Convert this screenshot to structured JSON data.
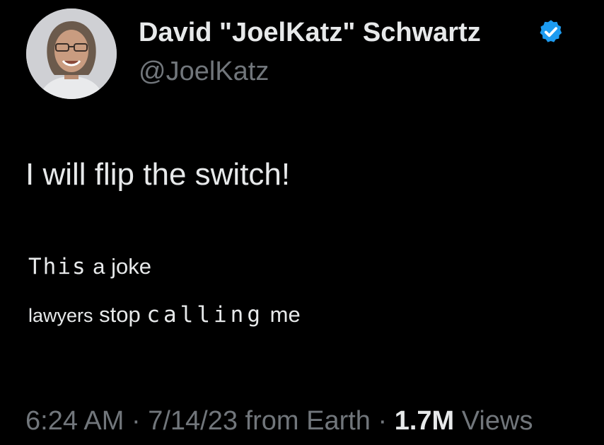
{
  "author": {
    "display_name": "David \"JoelKatz\" Schwartz",
    "handle": "@JoelKatz",
    "verified_icon": "verified-badge-icon",
    "verified_color": "#1d9bf0"
  },
  "tweet": {
    "line1": "I will flip the switch!",
    "line2": {
      "part1": "This",
      "part2": " a ",
      "part3": "joke"
    },
    "line3": {
      "part1": "lawyers",
      "part2": " stop ",
      "part3": "calling",
      "part4": " me"
    }
  },
  "meta": {
    "time": "6:24 AM",
    "sep1": " · ",
    "date": "7/14/23",
    "source": " from Earth",
    "sep2": " · ",
    "views_count": "1.7M",
    "views_label": " Views"
  },
  "colors": {
    "background": "#000000",
    "text_primary": "#e7e9ea",
    "text_secondary": "#71767b"
  }
}
